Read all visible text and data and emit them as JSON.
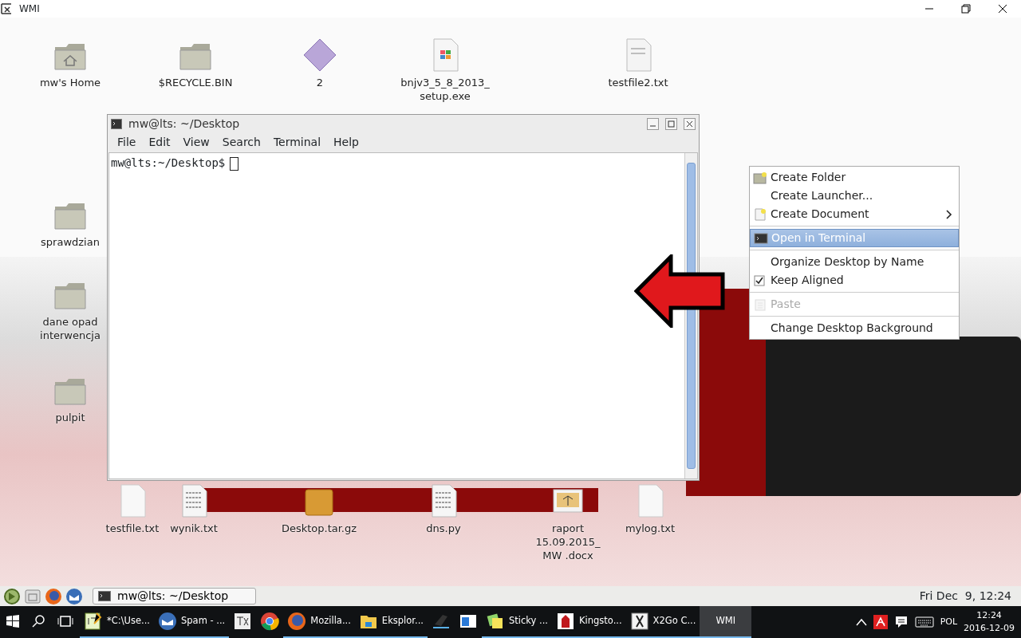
{
  "window": {
    "title": "WMI"
  },
  "desktop_icons": [
    {
      "label": "mw's Home",
      "kind": "home"
    },
    {
      "label": "$RECYCLE.BIN",
      "kind": "folder"
    },
    {
      "label": "2",
      "kind": "diamond"
    },
    {
      "label": "bnjv3_5_8_2013_ setup.exe",
      "kind": "exe"
    },
    {
      "label": "testfile2.txt",
      "kind": "text"
    },
    {
      "label": "sprawdzian",
      "kind": "folder"
    },
    {
      "label": "dane opad interwencja",
      "kind": "folder"
    },
    {
      "label": "pulpit",
      "kind": "folder"
    },
    {
      "label": "testfile.txt",
      "kind": "blank"
    },
    {
      "label": "wynik.txt",
      "kind": "data"
    },
    {
      "label": "Desktop.tar.gz",
      "kind": "archive"
    },
    {
      "label": "dns.py",
      "kind": "data"
    },
    {
      "label": "raport 15.09.2015_ MW .docx",
      "kind": "image"
    },
    {
      "label": "mylog.txt",
      "kind": "blank"
    }
  ],
  "terminal": {
    "title": "mw@lts: ~/Desktop",
    "menu": [
      "File",
      "Edit",
      "View",
      "Search",
      "Terminal",
      "Help"
    ],
    "prompt": "mw@lts:~/Desktop$"
  },
  "context_menu": [
    {
      "kind": "item",
      "label": "Create Folder",
      "selected": false,
      "disabled": false,
      "submenu": false
    },
    {
      "kind": "item",
      "label": "Create Launcher...",
      "selected": false,
      "disabled": false,
      "submenu": false
    },
    {
      "kind": "item",
      "label": "Create Document",
      "selected": false,
      "disabled": false,
      "submenu": true
    },
    {
      "kind": "separator"
    },
    {
      "kind": "item",
      "label": "Open in Terminal",
      "selected": true,
      "disabled": false,
      "submenu": false
    },
    {
      "kind": "separator"
    },
    {
      "kind": "item",
      "label": "Organize Desktop by Name",
      "selected": false,
      "disabled": false,
      "submenu": false
    },
    {
      "kind": "check",
      "label": "Keep Aligned",
      "checked": true,
      "selected": false,
      "disabled": false,
      "submenu": false
    },
    {
      "kind": "separator"
    },
    {
      "kind": "item",
      "label": "Paste",
      "selected": false,
      "disabled": true,
      "submenu": false
    },
    {
      "kind": "separator"
    },
    {
      "kind": "item",
      "label": "Change Desktop Background",
      "selected": false,
      "disabled": false,
      "submenu": false
    }
  ],
  "panel": {
    "tasks": [
      {
        "label": "mw@lts: ~/Desktop"
      }
    ],
    "clock": "Fri Dec  9, 12:24"
  },
  "taskbar": {
    "apps": [
      {
        "kind": "notepad",
        "label": "*C:\\Use...",
        "running": true,
        "selected": false
      },
      {
        "kind": "mail",
        "label": "Spam - ...",
        "running": true,
        "selected": false
      },
      {
        "kind": "tex",
        "running": false,
        "selected": false
      },
      {
        "kind": "chrome",
        "running": false,
        "selected": false
      },
      {
        "kind": "firefox",
        "label": "Mozilla...",
        "running": true,
        "selected": false
      },
      {
        "kind": "explorer",
        "label": "Eksplor...",
        "running": true,
        "selected": false
      },
      {
        "kind": "stand",
        "running": false,
        "selected": false
      },
      {
        "kind": "window",
        "running": false,
        "selected": false
      },
      {
        "kind": "sticky",
        "label": "Sticky ...",
        "running": true,
        "selected": false
      },
      {
        "kind": "kingston",
        "label": "Kingsto...",
        "running": true,
        "selected": false
      },
      {
        "kind": "x2go",
        "label": "X2Go C...",
        "running": true,
        "selected": false
      },
      {
        "kind": "none",
        "label": "WMI",
        "running": true,
        "selected": true
      }
    ],
    "language": "POL",
    "time": "12:24",
    "date": "2016-12-09"
  }
}
